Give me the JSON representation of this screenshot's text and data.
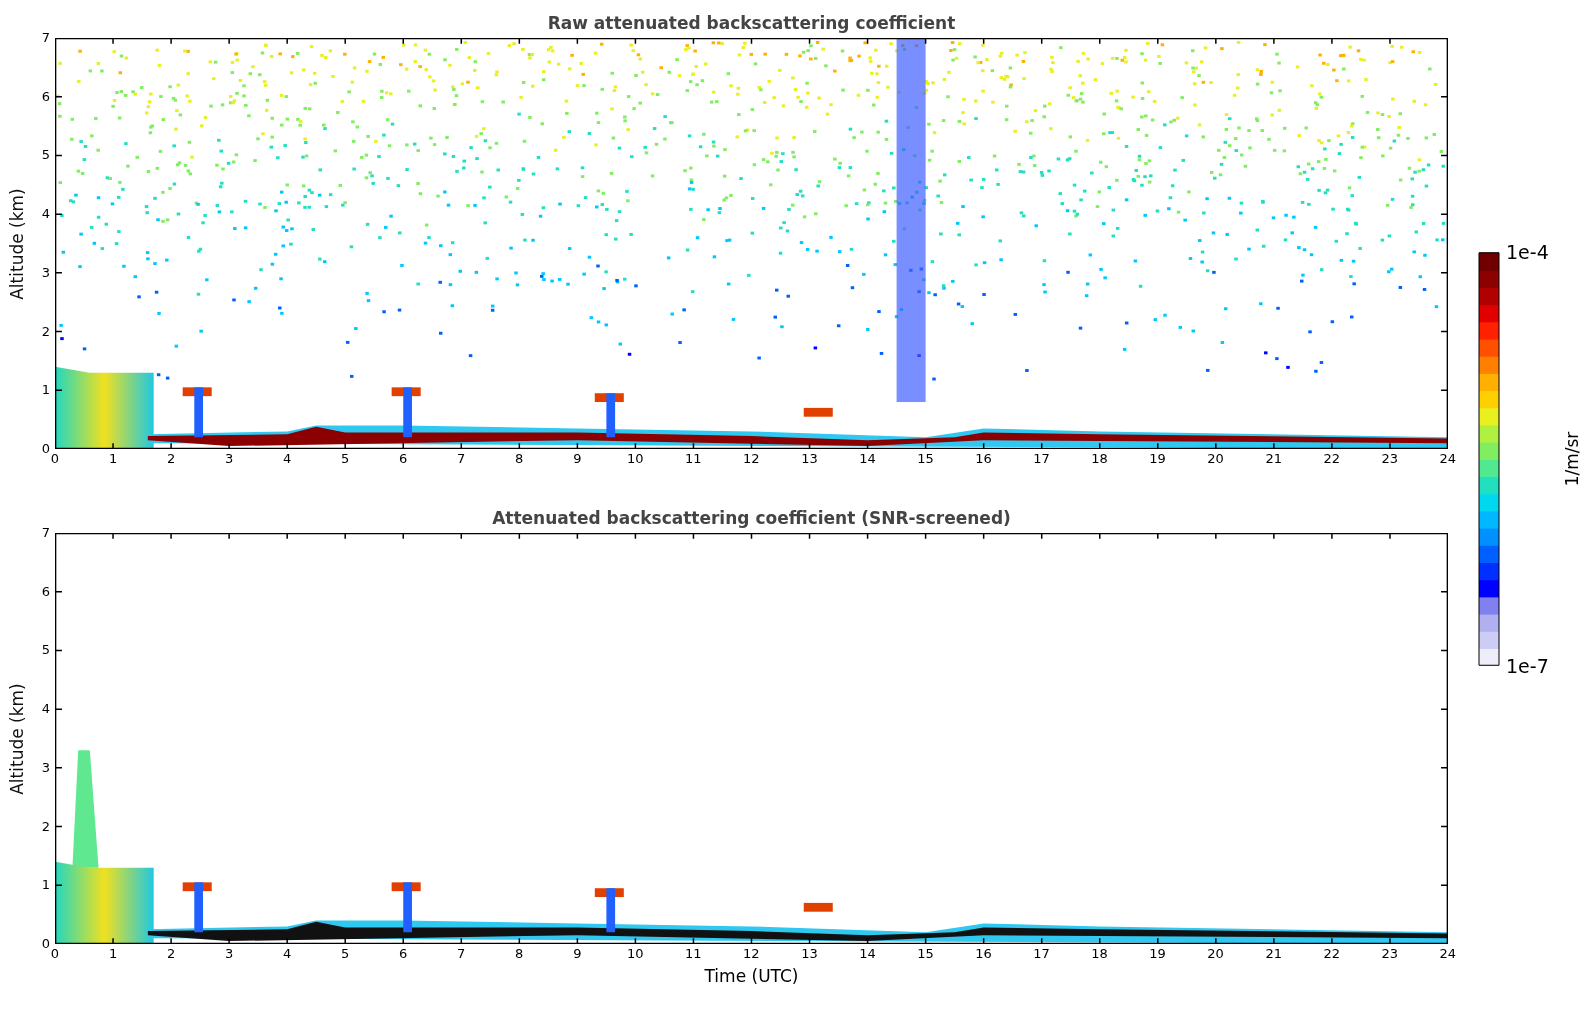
{
  "panels": [
    {
      "kind": "raw",
      "title": "Raw attenuated backscattering coefficient",
      "ylabel": "Altitude (km)",
      "yticks": [
        "7",
        "6",
        "5",
        "4",
        "3",
        "2",
        "1",
        "0"
      ],
      "xticks": [
        "0",
        "1",
        "2",
        "3",
        "4",
        "5",
        "6",
        "7",
        "8",
        "9",
        "10",
        "11",
        "12",
        "13",
        "14",
        "15",
        "16",
        "17",
        "18",
        "19",
        "20",
        "21",
        "22",
        "23",
        "24"
      ]
    },
    {
      "kind": "screened",
      "title": "Attenuated backscattering coefficient (SNR-screened)",
      "ylabel": "Altitude (km)",
      "xlabel": "Time (UTC)",
      "yticks": [
        "7",
        "6",
        "5",
        "4",
        "3",
        "2",
        "1",
        "0"
      ],
      "xticks": [
        "0",
        "1",
        "2",
        "3",
        "4",
        "5",
        "6",
        "7",
        "8",
        "9",
        "10",
        "11",
        "12",
        "13",
        "14",
        "15",
        "16",
        "17",
        "18",
        "19",
        "20",
        "21",
        "22",
        "23",
        "24"
      ]
    }
  ],
  "colorbar": {
    "max": "1e-4",
    "min": "1e-7",
    "label": "1/m/sr"
  }
}
